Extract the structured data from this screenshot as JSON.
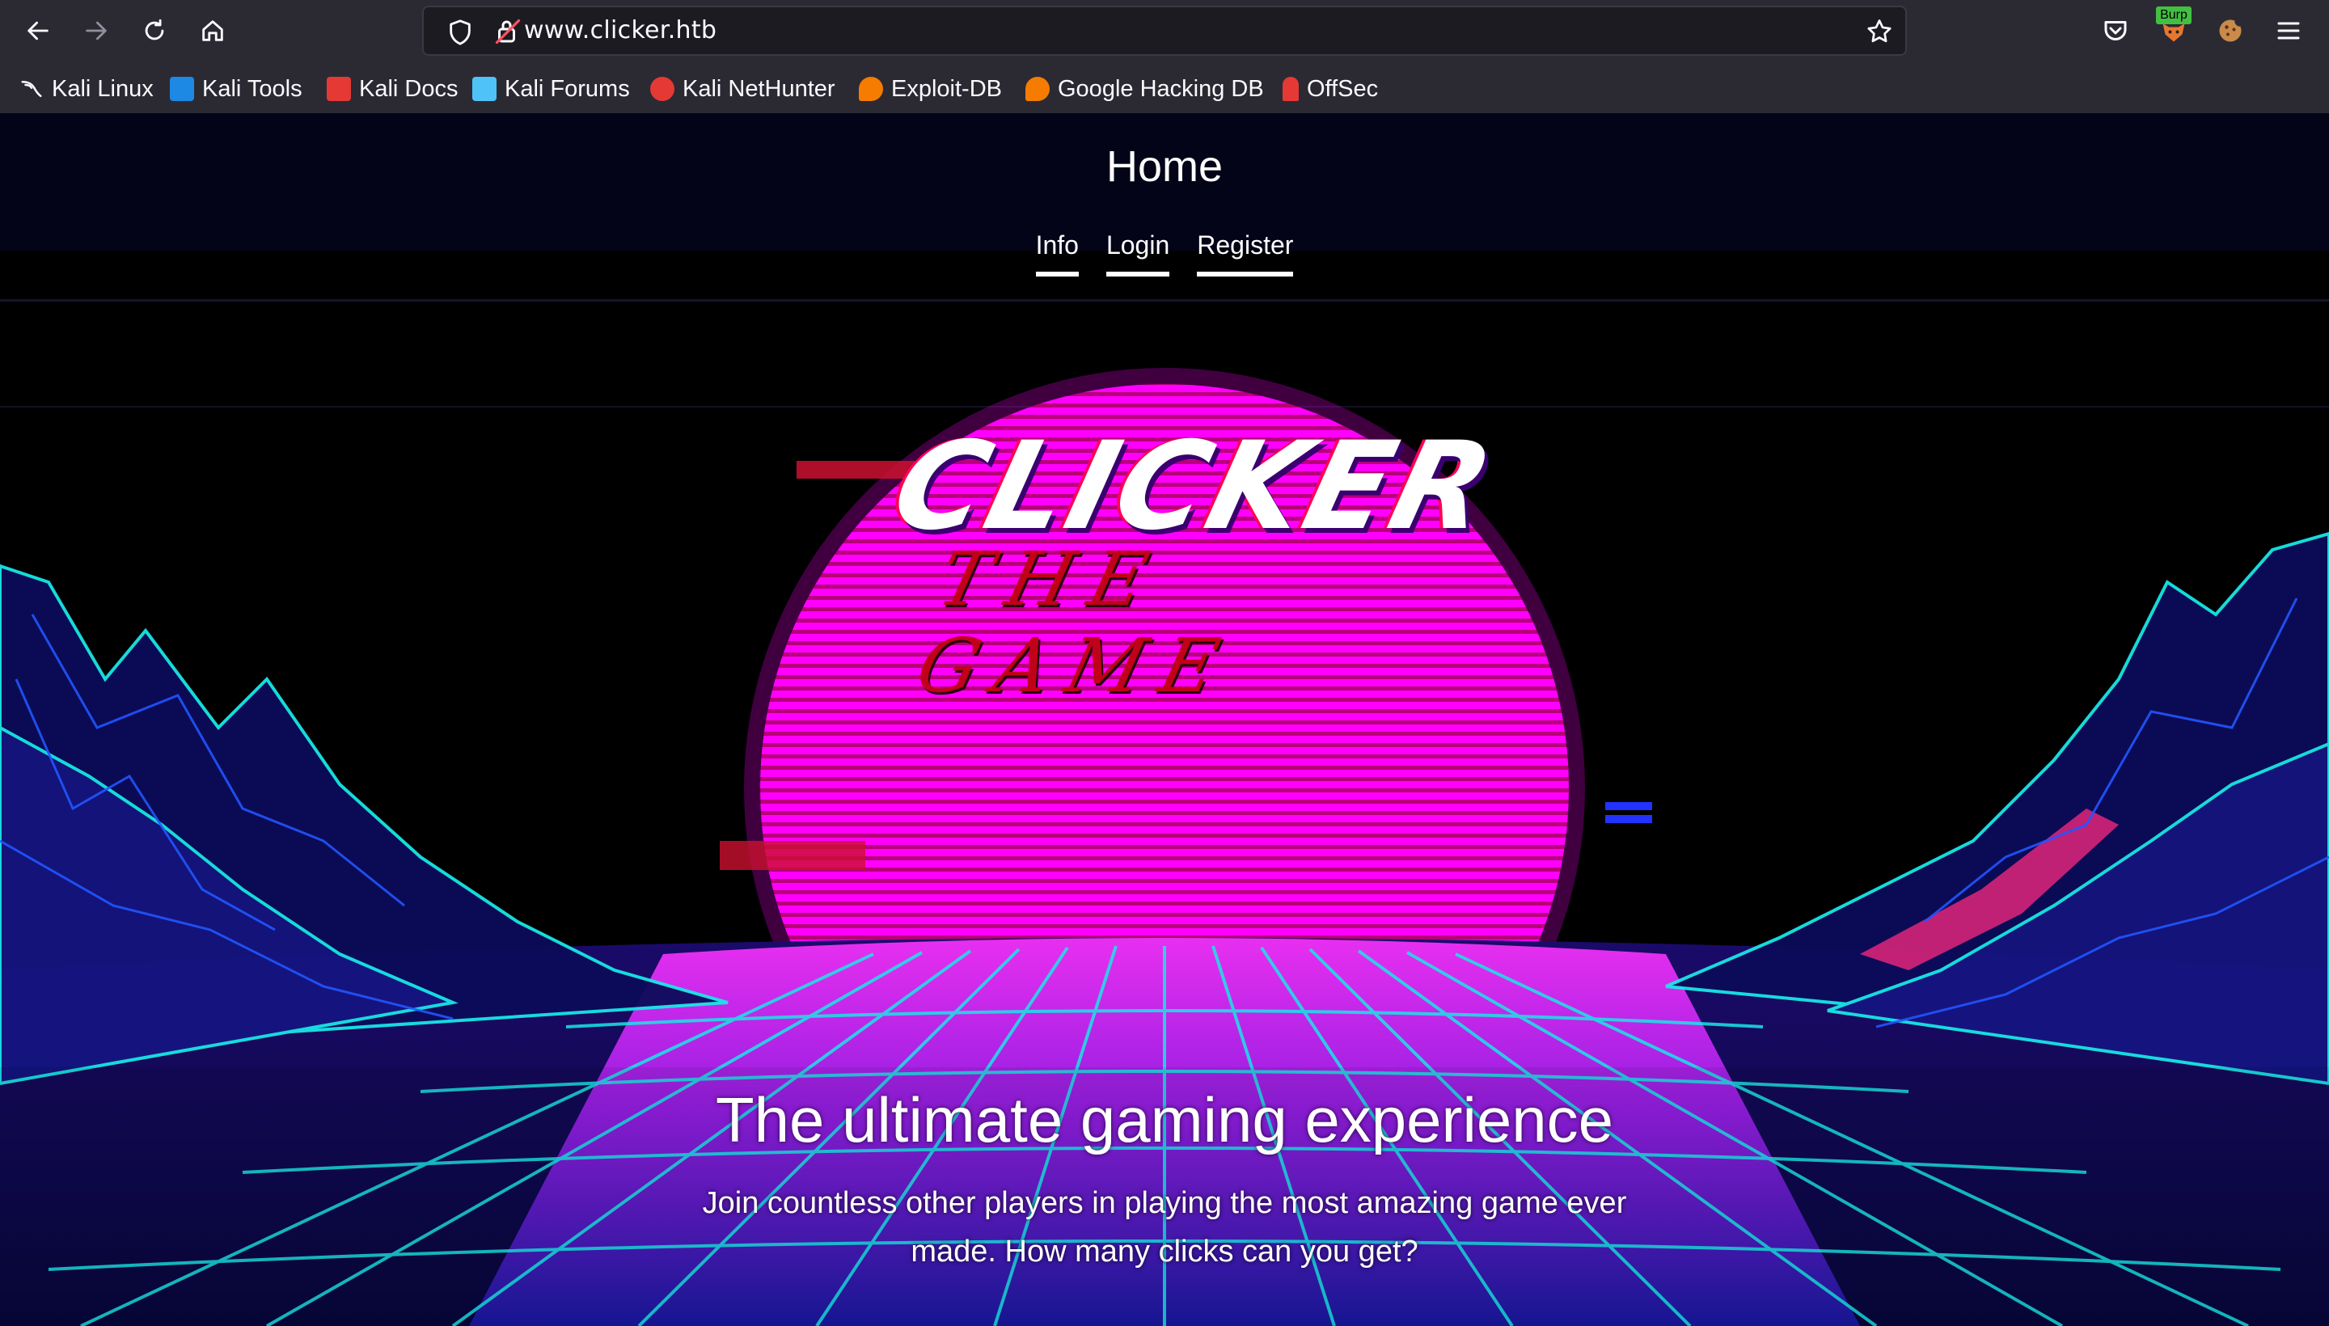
{
  "browser": {
    "url": "www.clicker.htb",
    "burp_badge": "Burp",
    "bookmarks": [
      {
        "label": "Kali Linux",
        "icon": "kali-dragon-icon",
        "color": "#367bf0"
      },
      {
        "label": "Kali Tools",
        "icon": "kali-tools-icon",
        "color": "#1e88e5"
      },
      {
        "label": "Kali Docs",
        "icon": "kali-docs-icon",
        "color": "#e53935"
      },
      {
        "label": "Kali Forums",
        "icon": "kali-forums-icon",
        "color": "#4fc3f7"
      },
      {
        "label": "Kali NetHunter",
        "icon": "kali-nethunter-icon",
        "color": "#e53935"
      },
      {
        "label": "Exploit-DB",
        "icon": "exploit-db-icon",
        "color": "#f57c00"
      },
      {
        "label": "Google Hacking DB",
        "icon": "ghdb-icon",
        "color": "#f57c00"
      },
      {
        "label": "OffSec",
        "icon": "offsec-icon",
        "color": "#e53935"
      }
    ]
  },
  "site": {
    "title": "Home",
    "nav": [
      "Info",
      "Login",
      "Register"
    ],
    "logo_main": "CLICKER",
    "logo_sub": "THE GAME",
    "headline": "The ultimate gaming experience",
    "subline": "Join countless other players in playing the most amazing game ever made. How many clicks can you get?"
  },
  "colors": {
    "sun": "#ff00ff",
    "grid_cyan": "#19e6e6",
    "grid_blue": "#2222cc",
    "chrome_bg": "#2b2a33",
    "urlbar_bg": "#1c1b22"
  }
}
